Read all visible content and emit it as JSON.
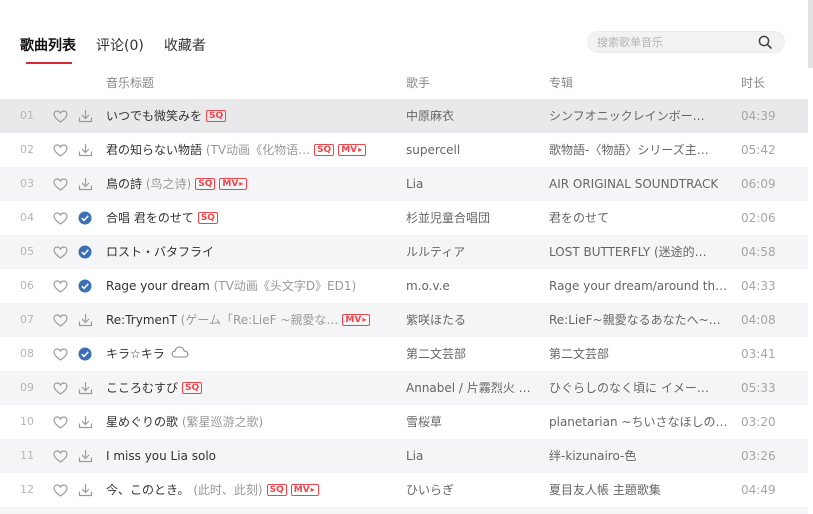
{
  "tabs": [
    {
      "label": "歌曲列表",
      "active": true
    },
    {
      "label": "评论(0)",
      "active": false
    },
    {
      "label": "收藏者",
      "active": false
    }
  ],
  "search": {
    "placeholder": "搜索歌单音乐",
    "icon": "search-icon"
  },
  "columns": {
    "title": "音乐标题",
    "artist": "歌手",
    "album": "专辑",
    "duration": "时长"
  },
  "colors": {
    "accent": "#d9293b",
    "badge": "#e5484d",
    "downloaded": "#3b6fb6"
  },
  "songs": [
    {
      "index": "01",
      "title": "いつでも微笑みを",
      "alias": "",
      "sq": true,
      "mv": false,
      "cloud": false,
      "downloaded": false,
      "artist": "中原麻衣",
      "album": "シンフオニックレインボー…",
      "duration": "04:39"
    },
    {
      "index": "02",
      "title": "君の知らない物語",
      "alias": "(TV动画《化物语…",
      "sq": true,
      "mv": true,
      "cloud": false,
      "downloaded": false,
      "artist": "supercell",
      "album": "歌物語-〈物語〉シリーズ主…",
      "duration": "05:42"
    },
    {
      "index": "03",
      "title": "鳥の詩",
      "alias": "(鸟之诗)",
      "sq": true,
      "mv": true,
      "cloud": false,
      "downloaded": false,
      "artist": "Lia",
      "album": "AIR ORIGINAL SOUNDTRACK",
      "duration": "06:09"
    },
    {
      "index": "04",
      "title": "合唱 君をのせて",
      "alias": "",
      "sq": true,
      "mv": false,
      "cloud": false,
      "downloaded": true,
      "artist": "杉並児童合唱団",
      "album": "君をのせて",
      "duration": "02:06"
    },
    {
      "index": "05",
      "title": "ロスト・バタフライ",
      "alias": "",
      "sq": false,
      "mv": false,
      "cloud": false,
      "downloaded": true,
      "artist": "ルルティア",
      "album": "LOST BUTTERFLY (迷途的…",
      "duration": "04:58"
    },
    {
      "index": "06",
      "title": "Rage your dream",
      "alias": "(TV动画《头文字D》ED1)",
      "sq": false,
      "mv": false,
      "cloud": false,
      "downloaded": true,
      "artist": "m.o.v.e",
      "album": "Rage your dream/around the…",
      "duration": "04:33"
    },
    {
      "index": "07",
      "title": "Re:TrymenT",
      "alias": "(ゲーム「Re:LieF ~親愛な…",
      "sq": false,
      "mv": true,
      "cloud": false,
      "downloaded": false,
      "artist": "紫咲ほたる",
      "album": "Re:LieF~親愛なるあなたへ~…",
      "duration": "04:08"
    },
    {
      "index": "08",
      "title": "キラ☆キラ",
      "alias": "",
      "sq": false,
      "mv": false,
      "cloud": true,
      "downloaded": true,
      "artist": "第二文芸部",
      "album": "第二文芸部",
      "duration": "03:41"
    },
    {
      "index": "09",
      "title": "こころむすび",
      "alias": "",
      "sq": true,
      "mv": false,
      "cloud": false,
      "downloaded": false,
      "artist": "Annabel / 片霧烈火 …",
      "album": "ひぐらしのなく頃に イメー…",
      "duration": "05:33"
    },
    {
      "index": "10",
      "title": "星めぐりの歌",
      "alias": "(繁星巡游之歌)",
      "sq": false,
      "mv": false,
      "cloud": false,
      "downloaded": false,
      "artist": "雪桜草",
      "album": "planetarian ~ちいさなほしの…",
      "duration": "03:20"
    },
    {
      "index": "11",
      "title": "I miss you Lia solo",
      "alias": "",
      "sq": false,
      "mv": false,
      "cloud": false,
      "downloaded": false,
      "artist": "Lia",
      "album": "绊-kizunairo-色",
      "duration": "03:26"
    },
    {
      "index": "12",
      "title": "今、このとき。",
      "alias": "(此时、此刻)",
      "sq": true,
      "mv": true,
      "cloud": false,
      "downloaded": false,
      "artist": "ひいらぎ",
      "album": "夏目友人帳 主題歌集",
      "duration": "04:49"
    }
  ],
  "badges": {
    "sq": "SQ",
    "mv": "MV"
  }
}
